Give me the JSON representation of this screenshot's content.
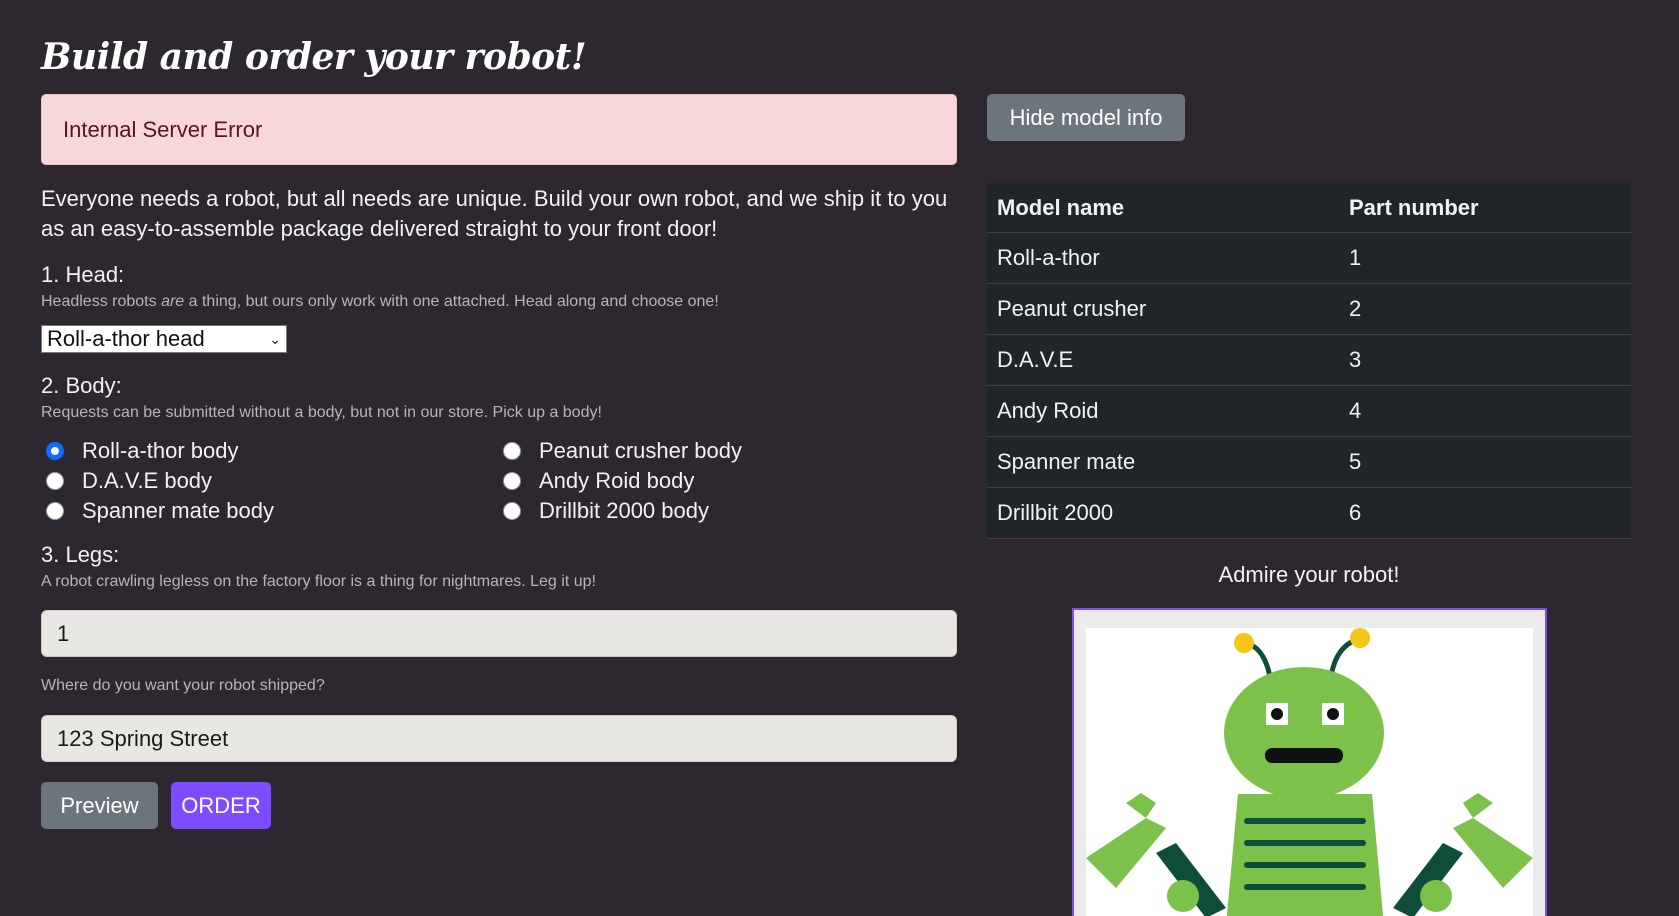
{
  "page": {
    "title": "Build and order your robot!"
  },
  "alert": {
    "message": "Internal Server Error"
  },
  "intro": "Everyone needs a robot, but all needs are unique. Build your own robot, and we ship it to you as an easy-to-assemble package delivered straight to your front door!",
  "head": {
    "label": "1. Head:",
    "help_before": "Headless robots ",
    "help_em": "are",
    "help_after": " a thing, but ours only work with one attached. Head along and choose one!",
    "selected": "Roll-a-thor head"
  },
  "body": {
    "label": "2. Body:",
    "help": "Requests can be submitted without a body, but not in our store. Pick up a body!",
    "options": [
      {
        "label": "Roll-a-thor body",
        "checked": true
      },
      {
        "label": "Peanut crusher body",
        "checked": false
      },
      {
        "label": "D.A.V.E body",
        "checked": false
      },
      {
        "label": "Andy Roid body",
        "checked": false
      },
      {
        "label": "Spanner mate body",
        "checked": false
      },
      {
        "label": "Drillbit 2000 body",
        "checked": false
      }
    ]
  },
  "legs": {
    "label": "3. Legs:",
    "help": "A robot crawling legless on the factory floor is a thing for nightmares. Leg it up!",
    "value": "1"
  },
  "address": {
    "help": "Where do you want your robot shipped?",
    "value": "123 Spring Street"
  },
  "buttons": {
    "preview": "Preview",
    "order": "ORDER",
    "hide_model_info": "Hide model info"
  },
  "models": {
    "headers": [
      "Model name",
      "Part number"
    ],
    "rows": [
      [
        "Roll-a-thor",
        "1"
      ],
      [
        "Peanut crusher",
        "2"
      ],
      [
        "D.A.V.E",
        "3"
      ],
      [
        "Andy Roid",
        "4"
      ],
      [
        "Spanner mate",
        "5"
      ],
      [
        "Drillbit 2000",
        "6"
      ]
    ]
  },
  "preview": {
    "caption": "Admire your robot!"
  },
  "colors": {
    "background": "#2d272f",
    "accent": "#7c4dff",
    "secondary": "#6c757d",
    "alert_bg": "#f8d7da",
    "radio_checked": "#0d6efd",
    "robot_green": "#7cc24a",
    "robot_dark": "#0d4d3a",
    "antenna_tip": "#f5c518"
  }
}
